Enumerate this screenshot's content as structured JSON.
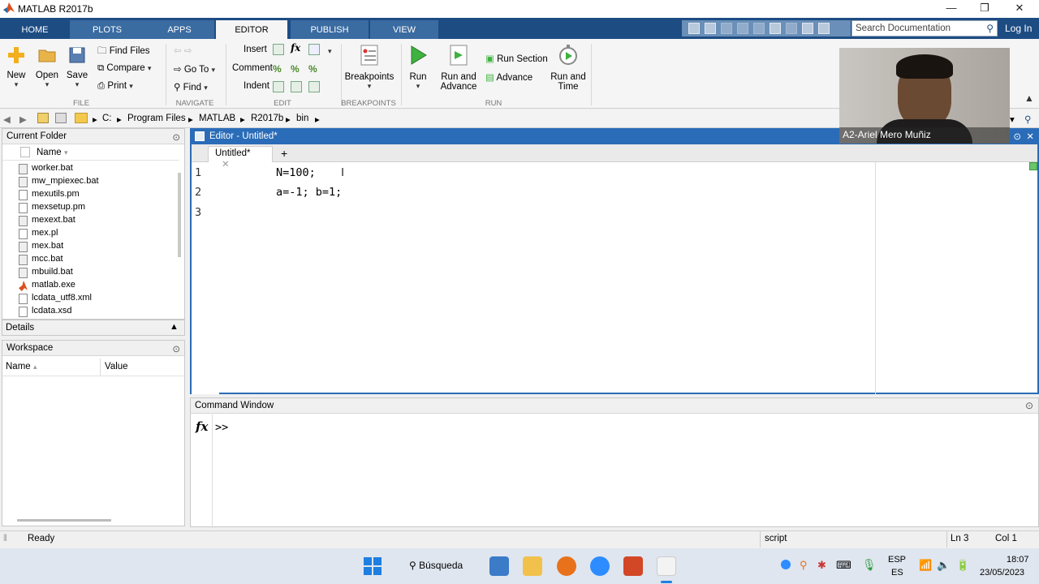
{
  "window": {
    "title": "MATLAB R2017b",
    "minimize": "—",
    "restore": "❐",
    "close": "✕"
  },
  "tabs": [
    {
      "label": "HOME"
    },
    {
      "label": "PLOTS"
    },
    {
      "label": "APPS"
    },
    {
      "label": "EDITOR"
    },
    {
      "label": "PUBLISH"
    },
    {
      "label": "VIEW"
    }
  ],
  "search": {
    "placeholder": "Search Documentation"
  },
  "login": "Log In",
  "ribbon": {
    "file": {
      "new": "New",
      "open": "Open",
      "save": "Save",
      "find_files": "Find Files",
      "compare": "Compare",
      "print": "Print",
      "group": "FILE"
    },
    "navigate": {
      "go_to": "Go To",
      "find": "Find",
      "group": "NAVIGATE"
    },
    "edit": {
      "insert": "Insert",
      "comment": "Comment",
      "indent": "Indent",
      "fx": "fx",
      "group": "EDIT"
    },
    "breakpoints": {
      "label": "Breakpoints",
      "group": "BREAKPOINTS"
    },
    "run": {
      "run": "Run",
      "run_advance_1": "Run and",
      "run_advance_2": "Advance",
      "run_section": "Run Section",
      "advance": "Advance",
      "run_time_1": "Run and",
      "run_time_2": "Time",
      "group": "RUN"
    }
  },
  "address": {
    "parts": [
      "C:",
      "Program Files",
      "MATLAB",
      "R2017b",
      "bin"
    ]
  },
  "current_folder": {
    "title": "Current Folder",
    "col_name": "Name",
    "files": [
      {
        "name": "worker.bat",
        "type": "bat"
      },
      {
        "name": "mw_mpiexec.bat",
        "type": "bat"
      },
      {
        "name": "mexutils.pm",
        "type": "file"
      },
      {
        "name": "mexsetup.pm",
        "type": "file"
      },
      {
        "name": "mexext.bat",
        "type": "bat"
      },
      {
        "name": "mex.pl",
        "type": "file"
      },
      {
        "name": "mex.bat",
        "type": "bat"
      },
      {
        "name": "mcc.bat",
        "type": "bat"
      },
      {
        "name": "mbuild.bat",
        "type": "bat"
      },
      {
        "name": "matlab.exe",
        "type": "exe"
      },
      {
        "name": "lcdata_utf8.xml",
        "type": "file"
      },
      {
        "name": "lcdata.xsd",
        "type": "file"
      }
    ]
  },
  "details": {
    "title": "Details"
  },
  "workspace": {
    "title": "Workspace",
    "col_name": "Name",
    "col_value": "Value"
  },
  "editor": {
    "title": "Editor - Untitled*",
    "tab": "Untitled*",
    "add_tab": "+",
    "lines": [
      {
        "num": "1",
        "code": "N=100;"
      },
      {
        "num": "2",
        "code": "a=-1; b=1;"
      },
      {
        "num": "3",
        "code": ""
      }
    ]
  },
  "command_window": {
    "title": "Command Window",
    "fx": "fx",
    "prompt": ">>"
  },
  "status": {
    "state": "Ready",
    "mode": "script",
    "ln": "Ln  3",
    "col": "Col  1"
  },
  "webcam": {
    "name": "A2-Ariel Mero Muñiz"
  },
  "taskbar": {
    "search": "Búsqueda",
    "lang_1": "ESP",
    "lang_2": "ES",
    "time": "18:07",
    "date": "23/05/2023"
  }
}
